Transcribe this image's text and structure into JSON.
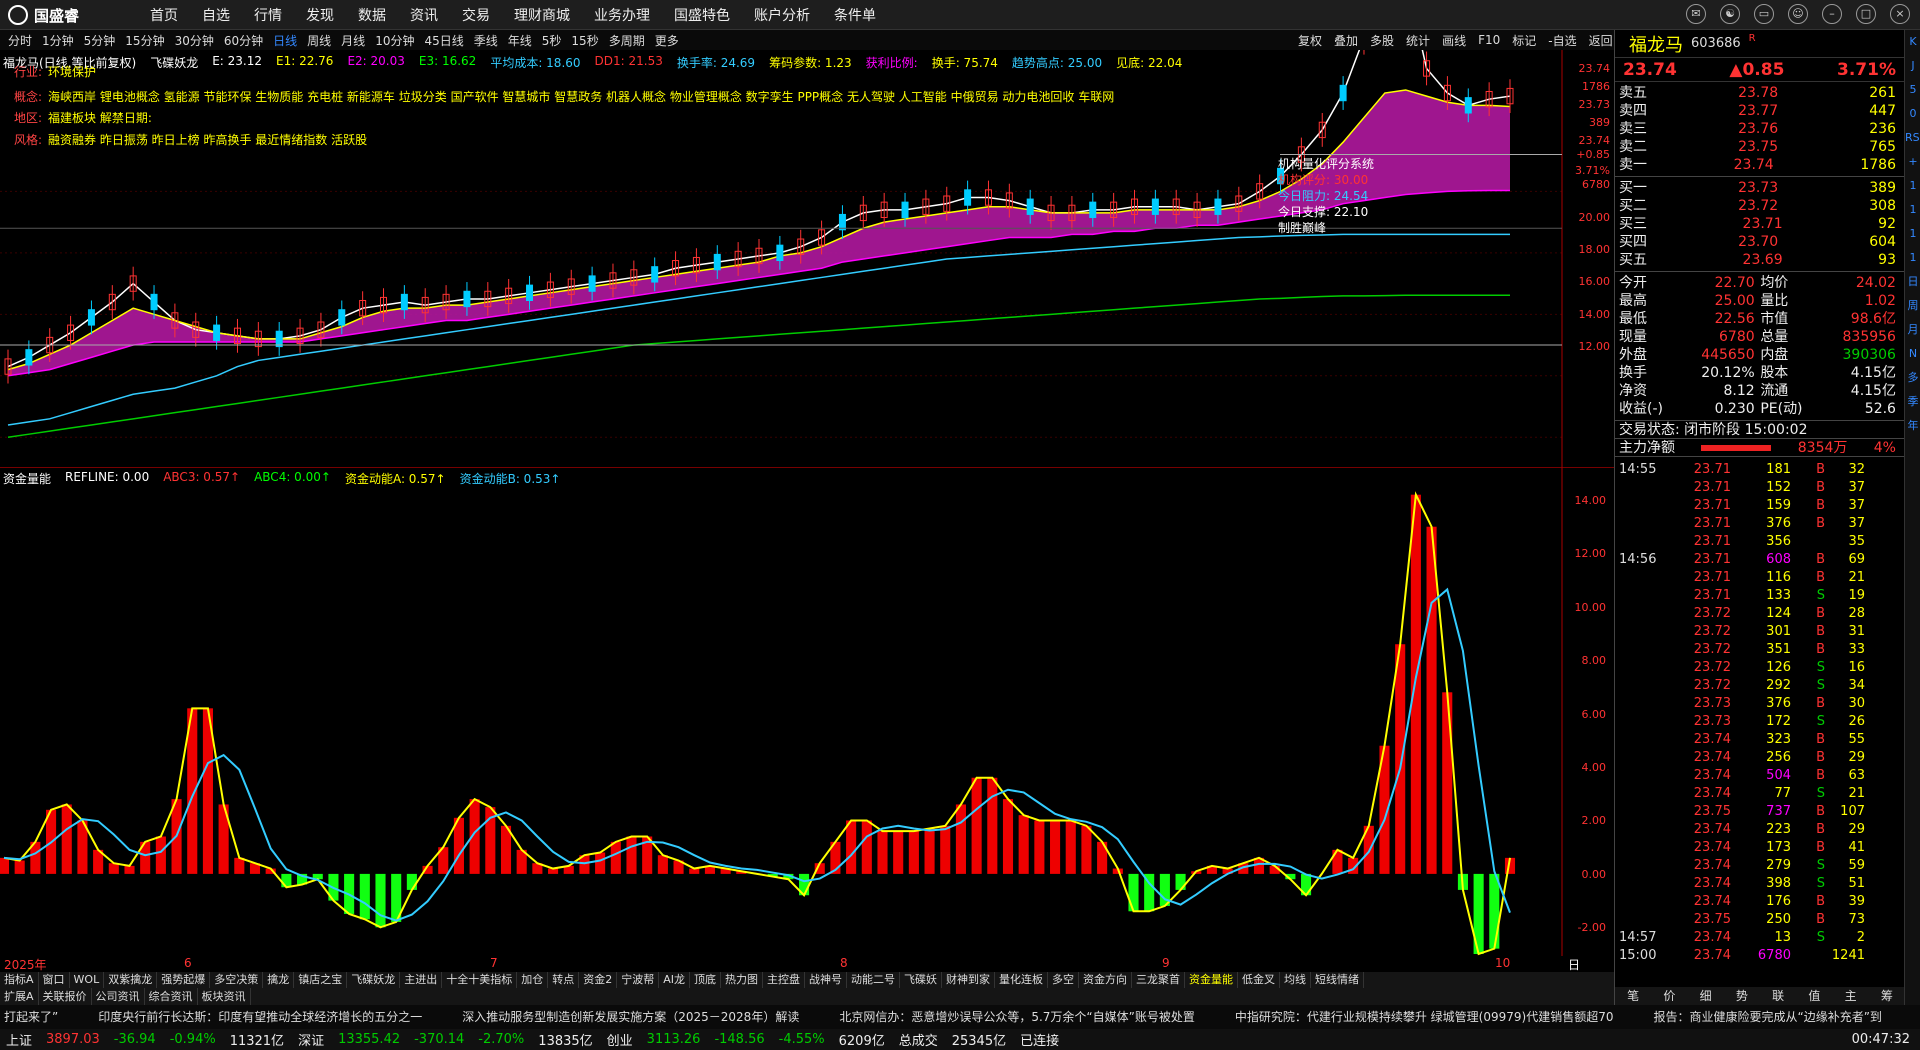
{
  "app": {
    "logo": "国盛睿"
  },
  "menu": [
    "首页",
    "自选",
    "行情",
    "发现",
    "数据",
    "资讯",
    "交易",
    "理财商城",
    "业务办理",
    "国盛特色",
    "账户分析",
    "条件单"
  ],
  "periods": [
    "分时",
    "1分钟",
    "5分钟",
    "15分钟",
    "30分钟",
    "60分钟",
    "日线",
    "周线",
    "月线",
    "10分钟",
    "45日线",
    "季线",
    "年线",
    "5秒",
    "15秒",
    "多周期",
    "更多"
  ],
  "active_period": "日线",
  "right_tools": [
    "复权",
    "叠加",
    "多股",
    "统计",
    "画线",
    "F10",
    "标记",
    "-自选",
    "返回"
  ],
  "indicator_main": [
    {
      "t": "福龙马(日线,等比前复权)",
      "c": "#fff"
    },
    {
      "t": "飞碟妖龙",
      "c": "#fff"
    },
    {
      "t": "E: 23.12",
      "c": "#fff"
    },
    {
      "t": "E1: 22.76",
      "c": "#ff0"
    },
    {
      "t": "E2: 20.03",
      "c": "#f0f"
    },
    {
      "t": "E3: 16.62",
      "c": "#0f0"
    },
    {
      "t": "平均成本: 18.60",
      "c": "#3cf"
    },
    {
      "t": "DD1: 21.53",
      "c": "#f33"
    },
    {
      "t": "换手率: 24.69",
      "c": "#3cf"
    },
    {
      "t": "筹码参数: 1.23",
      "c": "#ff0"
    },
    {
      "t": "获利比例:",
      "c": "#f0f"
    },
    {
      "t": "换手: 75.74",
      "c": "#ff0"
    },
    {
      "t": "趋势高点: 25.00",
      "c": "#3cf"
    },
    {
      "t": "见底: 22.04",
      "c": "#ff0"
    }
  ],
  "info_lines": [
    {
      "label": "行业:",
      "text": "环境保护"
    },
    {
      "label": "概念:",
      "text": "海峡西岸 锂电池概念 氢能源 节能环保 生物质能 充电桩 新能源车 垃圾分类 国产软件 智慧城市 智慧政务 机器人概念 物业管理概念 数字孪生 PPP概念 无人驾驶 人工智能 中俄贸易 动力电池回收 车联网"
    },
    {
      "label": "地区:",
      "text": "福建板块        解禁日期:"
    },
    {
      "label": "风格:",
      "text": "融资融券 昨日振荡 昨日上榜 昨高换手 最近情绪指数 活跃股"
    }
  ],
  "jigou": {
    "title": "机构量化评分系统",
    "score": "机构评分: 30.00",
    "resist": "今日阻力: 24.54",
    "support": "今日支撑: 22.10",
    "win": "制胜巅峰"
  },
  "main_yaxis": [
    "23.74",
    "1786",
    "23.73",
    "389",
    "23.74",
    "+0.85",
    "3.71%",
    "6780",
    "20.00",
    "18.00",
    "16.00",
    "14.00",
    "12.00"
  ],
  "chart_data": [
    {
      "type": "line",
      "title": "福龙马(日线,等比前复权)",
      "ylim": [
        11,
        24.6
      ],
      "x": [
        0,
        1,
        2,
        3,
        4,
        5,
        6,
        7,
        8,
        9,
        10,
        11,
        12,
        13,
        14,
        15,
        16,
        17,
        18,
        19,
        20,
        21,
        22,
        23,
        24,
        25,
        26,
        27,
        28,
        29,
        30,
        31,
        32,
        33,
        34,
        35,
        36,
        37,
        38,
        39,
        40,
        41,
        42,
        43,
        44,
        45,
        46,
        47,
        48,
        49,
        50,
        51,
        52,
        53,
        54,
        55,
        56,
        57,
        58,
        59,
        60,
        61,
        62,
        63,
        64,
        65,
        66,
        67,
        68,
        69,
        70,
        71,
        72,
        73,
        74,
        75,
        76,
        77,
        78,
        79,
        80,
        81,
        82,
        83,
        84
      ],
      "series": [
        {
          "name": "E",
          "color": "#fff",
          "values": [
            14.3,
            14.6,
            15.0,
            15.4,
            15.9,
            16.4,
            17.0,
            16.4,
            15.8,
            15.5,
            15.4,
            15.3,
            15.2,
            15.2,
            15.3,
            15.5,
            15.9,
            16.2,
            16.3,
            16.4,
            16.3,
            16.4,
            16.5,
            16.5,
            16.6,
            16.7,
            16.8,
            16.9,
            17.0,
            17.1,
            17.2,
            17.3,
            17.5,
            17.6,
            17.7,
            17.8,
            17.9,
            18.0,
            18.2,
            18.5,
            19.0,
            19.3,
            19.4,
            19.4,
            19.5,
            19.6,
            19.8,
            19.8,
            19.7,
            19.5,
            19.3,
            19.3,
            19.4,
            19.4,
            19.5,
            19.5,
            19.5,
            19.4,
            19.5,
            19.6,
            20.0,
            20.5,
            21.2,
            22.0,
            23.2,
            25.0,
            27.0,
            27.0,
            24.0,
            23.2,
            22.8,
            23.0,
            23.1
          ]
        },
        {
          "name": "E1",
          "color": "#ff0",
          "values": [
            14.2,
            14.4,
            14.7,
            15.0,
            15.4,
            15.8,
            16.2,
            16.0,
            15.8,
            15.6,
            15.4,
            15.3,
            15.2,
            15.2,
            15.2,
            15.4,
            15.6,
            15.9,
            16.1,
            16.2,
            16.2,
            16.3,
            16.3,
            16.4,
            16.5,
            16.6,
            16.7,
            16.8,
            16.9,
            17.0,
            17.1,
            17.2,
            17.3,
            17.4,
            17.5,
            17.6,
            17.7,
            17.9,
            18.0,
            18.2,
            18.5,
            18.8,
            19.0,
            19.1,
            19.2,
            19.3,
            19.4,
            19.5,
            19.5,
            19.4,
            19.3,
            19.3,
            19.3,
            19.3,
            19.4,
            19.4,
            19.4,
            19.4,
            19.4,
            19.5,
            19.7,
            20.0,
            20.4,
            20.9,
            21.6,
            22.4,
            23.2,
            23.3,
            23.1,
            22.9,
            22.8,
            22.8,
            22.76
          ]
        },
        {
          "name": "E2",
          "color": "#f0f",
          "values": [
            14.0,
            14.1,
            14.2,
            14.4,
            14.6,
            14.8,
            15.0,
            15.1,
            15.1,
            15.1,
            15.1,
            15.1,
            15.1,
            15.1,
            15.1,
            15.2,
            15.3,
            15.4,
            15.5,
            15.6,
            15.7,
            15.8,
            15.8,
            15.9,
            16.0,
            16.1,
            16.2,
            16.3,
            16.4,
            16.5,
            16.6,
            16.7,
            16.8,
            16.9,
            17.0,
            17.1,
            17.2,
            17.3,
            17.4,
            17.5,
            17.7,
            17.8,
            17.9,
            18.0,
            18.1,
            18.2,
            18.3,
            18.4,
            18.5,
            18.5,
            18.5,
            18.6,
            18.6,
            18.7,
            18.7,
            18.8,
            18.8,
            18.9,
            18.9,
            19.0,
            19.1,
            19.2,
            19.3,
            19.4,
            19.6,
            19.7,
            19.8,
            19.9,
            19.95,
            20.0,
            20.02,
            20.03,
            20.03
          ]
        },
        {
          "name": "平均成本",
          "color": "#3cf",
          "values": [
            12.4,
            12.5,
            12.6,
            12.8,
            13.0,
            13.2,
            13.4,
            13.5,
            13.6,
            13.8,
            14.0,
            14.3,
            14.5,
            14.6,
            14.7,
            14.8,
            14.9,
            15.0,
            15.1,
            15.2,
            15.3,
            15.4,
            15.5,
            15.6,
            15.7,
            15.8,
            15.9,
            16.0,
            16.1,
            16.2,
            16.3,
            16.4,
            16.5,
            16.6,
            16.7,
            16.8,
            16.9,
            17.0,
            17.1,
            17.2,
            17.3,
            17.4,
            17.5,
            17.6,
            17.7,
            17.8,
            17.85,
            17.9,
            17.95,
            18.0,
            18.05,
            18.1,
            18.15,
            18.2,
            18.25,
            18.3,
            18.35,
            18.4,
            18.45,
            18.5,
            18.52,
            18.55,
            18.57,
            18.58,
            18.6,
            18.6,
            18.6,
            18.6,
            18.6,
            18.6,
            18.6,
            18.6,
            18.6
          ]
        },
        {
          "name": "E3",
          "color": "#0c0",
          "values": [
            12.0,
            12.1,
            12.2,
            12.3,
            12.4,
            12.5,
            12.6,
            12.7,
            12.8,
            12.9,
            13.0,
            13.1,
            13.2,
            13.3,
            13.4,
            13.5,
            13.6,
            13.7,
            13.8,
            13.9,
            14.0,
            14.1,
            14.2,
            14.3,
            14.4,
            14.5,
            14.6,
            14.7,
            14.8,
            14.9,
            15.0,
            15.05,
            15.1,
            15.15,
            15.2,
            15.25,
            15.3,
            15.35,
            15.4,
            15.45,
            15.5,
            15.55,
            15.6,
            15.65,
            15.7,
            15.75,
            15.8,
            15.85,
            15.9,
            15.95,
            16.0,
            16.05,
            16.1,
            16.15,
            16.2,
            16.25,
            16.3,
            16.35,
            16.4,
            16.45,
            16.5,
            16.52,
            16.55,
            16.58,
            16.6,
            16.6,
            16.61,
            16.62,
            16.62,
            16.62,
            16.62,
            16.62,
            16.62
          ]
        }
      ]
    },
    {
      "type": "bar",
      "title": "资金量能",
      "ylim": [
        -3,
        14.6
      ],
      "values": [
        0.6,
        0.5,
        1.2,
        2.4,
        2.6,
        2.0,
        0.9,
        0.4,
        0.3,
        1.2,
        1.4,
        2.8,
        6.2,
        6.2,
        2.6,
        0.6,
        0.4,
        0.2,
        -0.5,
        -0.4,
        -0.2,
        -1.0,
        -1.5,
        -1.7,
        -2.0,
        -1.8,
        -0.6,
        0.3,
        1.0,
        2.1,
        2.8,
        2.5,
        1.8,
        0.9,
        0.4,
        0.2,
        0.3,
        0.7,
        0.8,
        1.2,
        1.4,
        1.4,
        0.7,
        0.5,
        0.2,
        0.3,
        0.2,
        0.1,
        0.0,
        -0.1,
        -0.2,
        -0.8,
        0.4,
        1.2,
        2.0,
        2.0,
        1.6,
        1.6,
        1.6,
        1.7,
        1.8,
        2.6,
        3.6,
        3.6,
        2.8,
        2.2,
        2.0,
        2.0,
        2.0,
        1.8,
        1.2,
        0.2,
        -1.4,
        -1.4,
        -1.2,
        -0.6,
        0.1,
        0.3,
        0.2,
        0.4,
        0.6,
        0.3,
        -0.2,
        -0.8,
        0.0,
        0.9,
        0.6,
        1.8,
        4.8,
        8.6,
        14.2,
        13.0,
        6.8,
        -0.6,
        -3.0,
        -2.8,
        0.6
      ],
      "series": [
        {
          "name": "资金动能A",
          "values": [
            0.57
          ]
        },
        {
          "name": "资金动能B",
          "values": [
            0.53
          ]
        }
      ]
    }
  ],
  "indicator_sub": [
    {
      "t": "资金量能",
      "c": "#fff"
    },
    {
      "t": "REFLINE: 0.00",
      "c": "#fff"
    },
    {
      "t": "ABC3: 0.57↑",
      "c": "#f33"
    },
    {
      "t": "ABC4: 0.00↑",
      "c": "#0f0"
    },
    {
      "t": "资金动能A: 0.57↑",
      "c": "#ff0"
    },
    {
      "t": "资金动能B: 0.53↑",
      "c": "#3cf"
    }
  ],
  "sub_yaxis": [
    "14.00",
    "12.00",
    "10.00",
    "8.00",
    "6.00",
    "4.00",
    "2.00",
    "0.00",
    "-2.00"
  ],
  "xaxis": {
    "year": "2025年",
    "ticks": [
      "6",
      "7",
      "8",
      "9",
      "10"
    ],
    "mode": "日线"
  },
  "indicator_tabs": [
    "指标A",
    "窗口",
    "WOL",
    "双紫擒龙",
    "强势起爆",
    "多空决策",
    "擒龙",
    "镇店之宝",
    "飞碟妖龙",
    "主进出",
    "十全十美指标",
    "加仓",
    "转点",
    "资金2",
    "宁波帮",
    "AI龙",
    "顶底",
    "热力图",
    "主控盘",
    "战神号",
    "动能二号",
    "飞碟妖",
    "财神到家",
    "量化连板",
    "多空",
    "资金方向",
    "三龙聚首",
    "资金量能",
    "低金叉",
    "均线",
    "短线情绪"
  ],
  "active_ind_tab": "资金量能",
  "sub_tabs": [
    "扩展A",
    "关联报价",
    "公司资讯",
    "综合资讯",
    "板块资讯"
  ],
  "ticker": [
    "打起来了”",
    "印度央行前行长达斯：印度有望推动全球经济增长的五分之一",
    "深入推动服务型制造创新发展实施方案（2025－2028年）解读",
    "北京网信办：恶意增炒误导公众等，5.7万余个“自媒体”账号被处置",
    "中指研究院：代建行业规模持续攀升 绿城管理(09979)代建销售额超70",
    "报告：商业健康险要完成从“边缘补充者”到"
  ],
  "status": {
    "sh": "上证",
    "sh_v": "3897.03",
    "sh_c": "-36.94",
    "sh_p": "-0.94%",
    "sh_a": "11321亿",
    "sz": "深证",
    "sz_v": "13355.42",
    "sz_c": "-370.14",
    "sz_p": "-2.70%",
    "sz_a": "13835亿",
    "cy": "创业",
    "cy_v": "3113.26",
    "cy_c": "-148.56",
    "cy_p": "-4.55%",
    "cy_a": "6209亿",
    "total": "总成交",
    "total_v": "25345亿",
    "conn": "已连接",
    "time": "00:47:32"
  },
  "quote": {
    "name": "福龙马",
    "code": "603686",
    "tag": "R",
    "price": "23.74",
    "chg": "▲0.85",
    "pct": "3.71%",
    "asks": [
      {
        "l": "卖五",
        "p": "23.78",
        "v": "261"
      },
      {
        "l": "卖四",
        "p": "23.77",
        "v": "447"
      },
      {
        "l": "卖三",
        "p": "23.76",
        "v": "236"
      },
      {
        "l": "卖二",
        "p": "23.75",
        "v": "765"
      },
      {
        "l": "卖一",
        "p": "23.74",
        "v": "1786"
      }
    ],
    "bids": [
      {
        "l": "买一",
        "p": "23.73",
        "v": "389"
      },
      {
        "l": "买二",
        "p": "23.72",
        "v": "308"
      },
      {
        "l": "买三",
        "p": "23.71",
        "v": "92"
      },
      {
        "l": "买四",
        "p": "23.70",
        "v": "604"
      },
      {
        "l": "买五",
        "p": "23.69",
        "v": "93"
      }
    ],
    "stats": [
      [
        "今开",
        "22.70",
        "均价",
        "24.02"
      ],
      [
        "最高",
        "25.00",
        "量比",
        "1.02"
      ],
      [
        "最低",
        "22.56",
        "市值",
        "98.6亿"
      ],
      [
        "现量",
        "6780",
        "总量",
        "835956"
      ],
      [
        "外盘",
        "445650",
        "内盘",
        "390306"
      ],
      [
        "换手",
        "20.12%",
        "股本",
        "4.15亿"
      ],
      [
        "净资",
        "8.12",
        "流通",
        "4.15亿"
      ],
      [
        "收益(-)",
        "0.230",
        "PE(动)",
        "52.6"
      ]
    ],
    "state": "交易状态: 闭市阶段 15:00:02",
    "net": "主力净额",
    "net_v": "8354万",
    "net_p": "4%"
  },
  "ticks": [
    [
      "14:55",
      "23.71",
      "181",
      "B",
      "32"
    ],
    [
      "",
      "23.71",
      "152",
      "B",
      "37"
    ],
    [
      "",
      "23.71",
      "159",
      "B",
      "37"
    ],
    [
      "",
      "23.71",
      "376",
      "B",
      "37"
    ],
    [
      "",
      "23.71",
      "356",
      "",
      "35"
    ],
    [
      "14:56",
      "23.71",
      "608",
      "B",
      "69"
    ],
    [
      "",
      "23.71",
      "116",
      "B",
      "21"
    ],
    [
      "",
      "23.71",
      "133",
      "S",
      "19"
    ],
    [
      "",
      "23.72",
      "124",
      "B",
      "28"
    ],
    [
      "",
      "23.72",
      "301",
      "B",
      "31"
    ],
    [
      "",
      "23.72",
      "351",
      "B",
      "33"
    ],
    [
      "",
      "23.72",
      "126",
      "S",
      "16"
    ],
    [
      "",
      "23.72",
      "292",
      "S",
      "34"
    ],
    [
      "",
      "23.73",
      "376",
      "B",
      "30"
    ],
    [
      "",
      "23.73",
      "172",
      "S",
      "26"
    ],
    [
      "",
      "23.74",
      "323",
      "B",
      "55"
    ],
    [
      "",
      "23.74",
      "256",
      "B",
      "29"
    ],
    [
      "",
      "23.74",
      "504",
      "B",
      "63"
    ],
    [
      "",
      "23.74",
      "77",
      "S",
      "21"
    ],
    [
      "",
      "23.75",
      "737",
      "B",
      "107"
    ],
    [
      "",
      "23.74",
      "223",
      "B",
      "29"
    ],
    [
      "",
      "23.74",
      "173",
      "B",
      "41"
    ],
    [
      "",
      "23.74",
      "279",
      "S",
      "59"
    ],
    [
      "",
      "23.74",
      "398",
      "S",
      "51"
    ],
    [
      "",
      "23.74",
      "176",
      "B",
      "39"
    ],
    [
      "",
      "23.75",
      "250",
      "B",
      "73"
    ],
    [
      "14:57",
      "23.74",
      "13",
      "S",
      "2"
    ],
    [
      "15:00",
      "23.74",
      "6780",
      "",
      "1241"
    ]
  ],
  "bottom_tabs": [
    "笔",
    "价",
    "细",
    "势",
    "联",
    "值",
    "主",
    "筹"
  ],
  "scroll_icons": [
    "K",
    "J",
    "5",
    "0",
    "RSI",
    "+",
    "1",
    "1",
    "1",
    "1",
    "日",
    "周",
    "月",
    "N",
    "多",
    "季",
    "年"
  ]
}
